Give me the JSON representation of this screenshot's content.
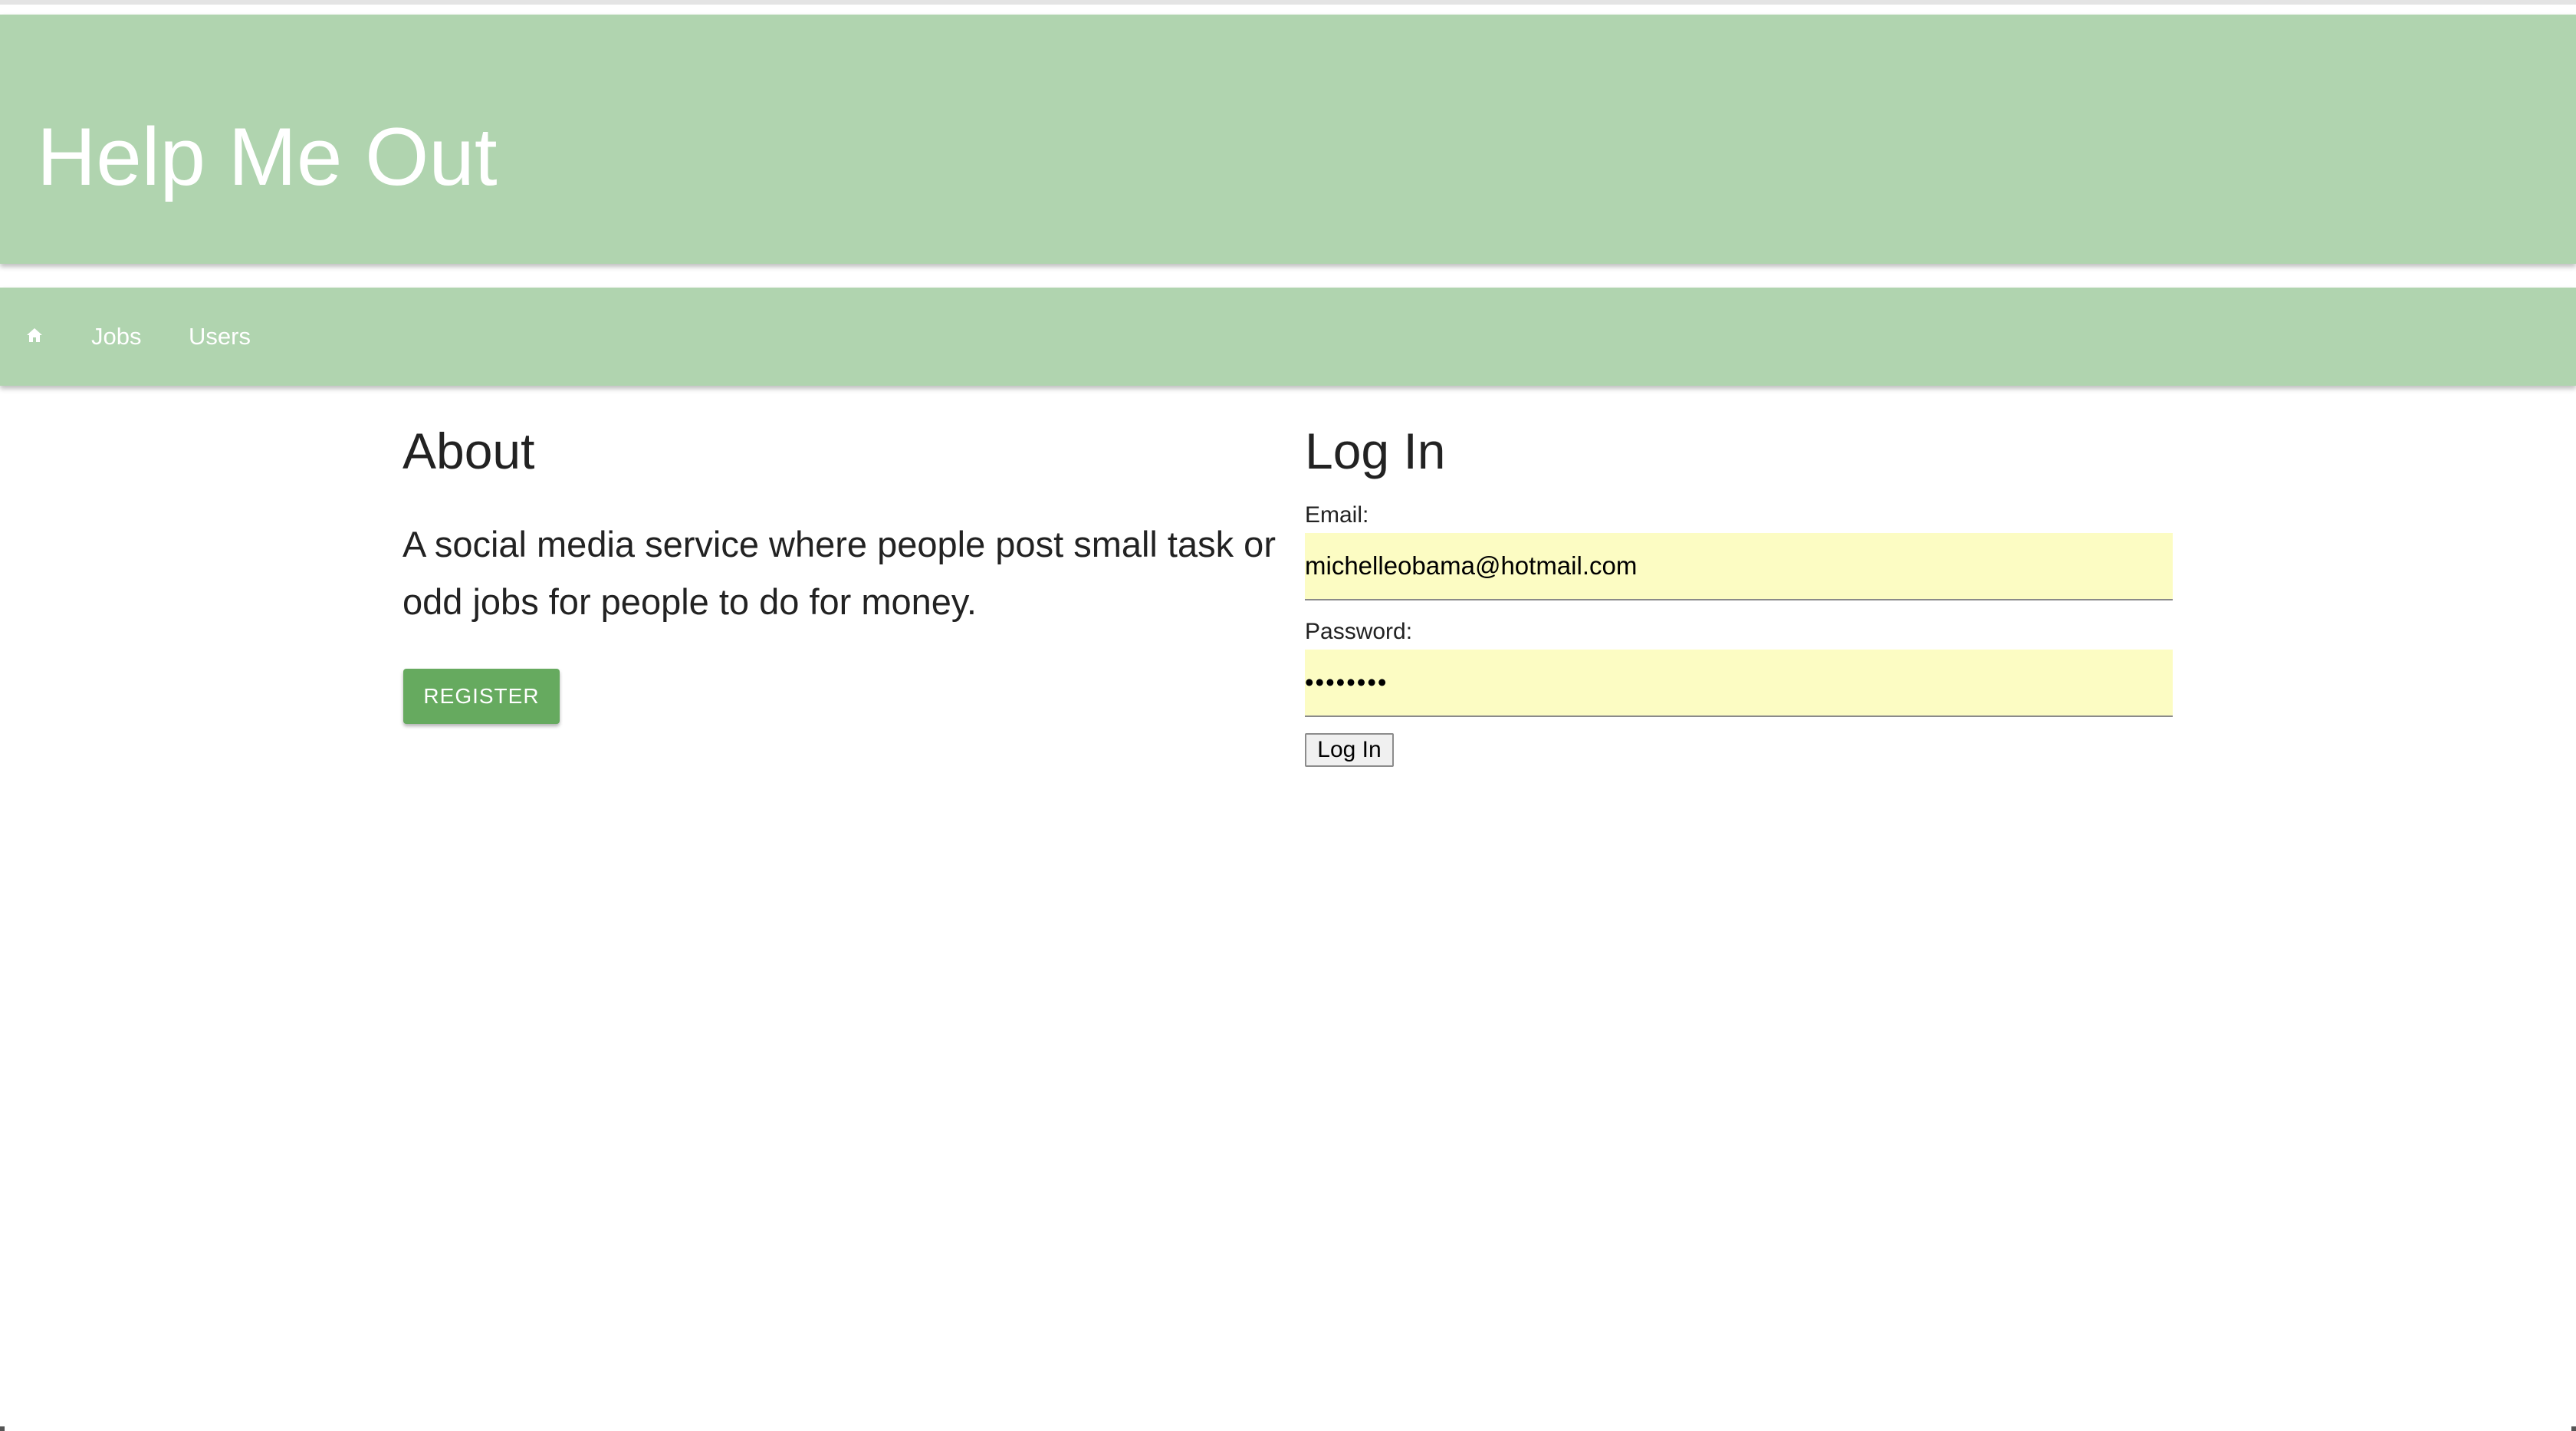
{
  "theme": {
    "header_bg": "#b0d4af",
    "register_bg": "#66aa5f",
    "autofill_bg": "#fcfcc3"
  },
  "header": {
    "title": "Help Me Out"
  },
  "navbar": {
    "home_icon": "home-icon",
    "links": [
      {
        "label": "Jobs"
      },
      {
        "label": "Users"
      }
    ]
  },
  "about": {
    "heading": "About",
    "description": "A social media service where people post small task or odd jobs for people to do for money.",
    "register_label": "REGISTER"
  },
  "login": {
    "heading": "Log In",
    "email_label": "Email:",
    "email_value": "michelleobama@hotmail.com",
    "password_label": "Password:",
    "password_value": "••••••••",
    "submit_label": "Log In"
  }
}
